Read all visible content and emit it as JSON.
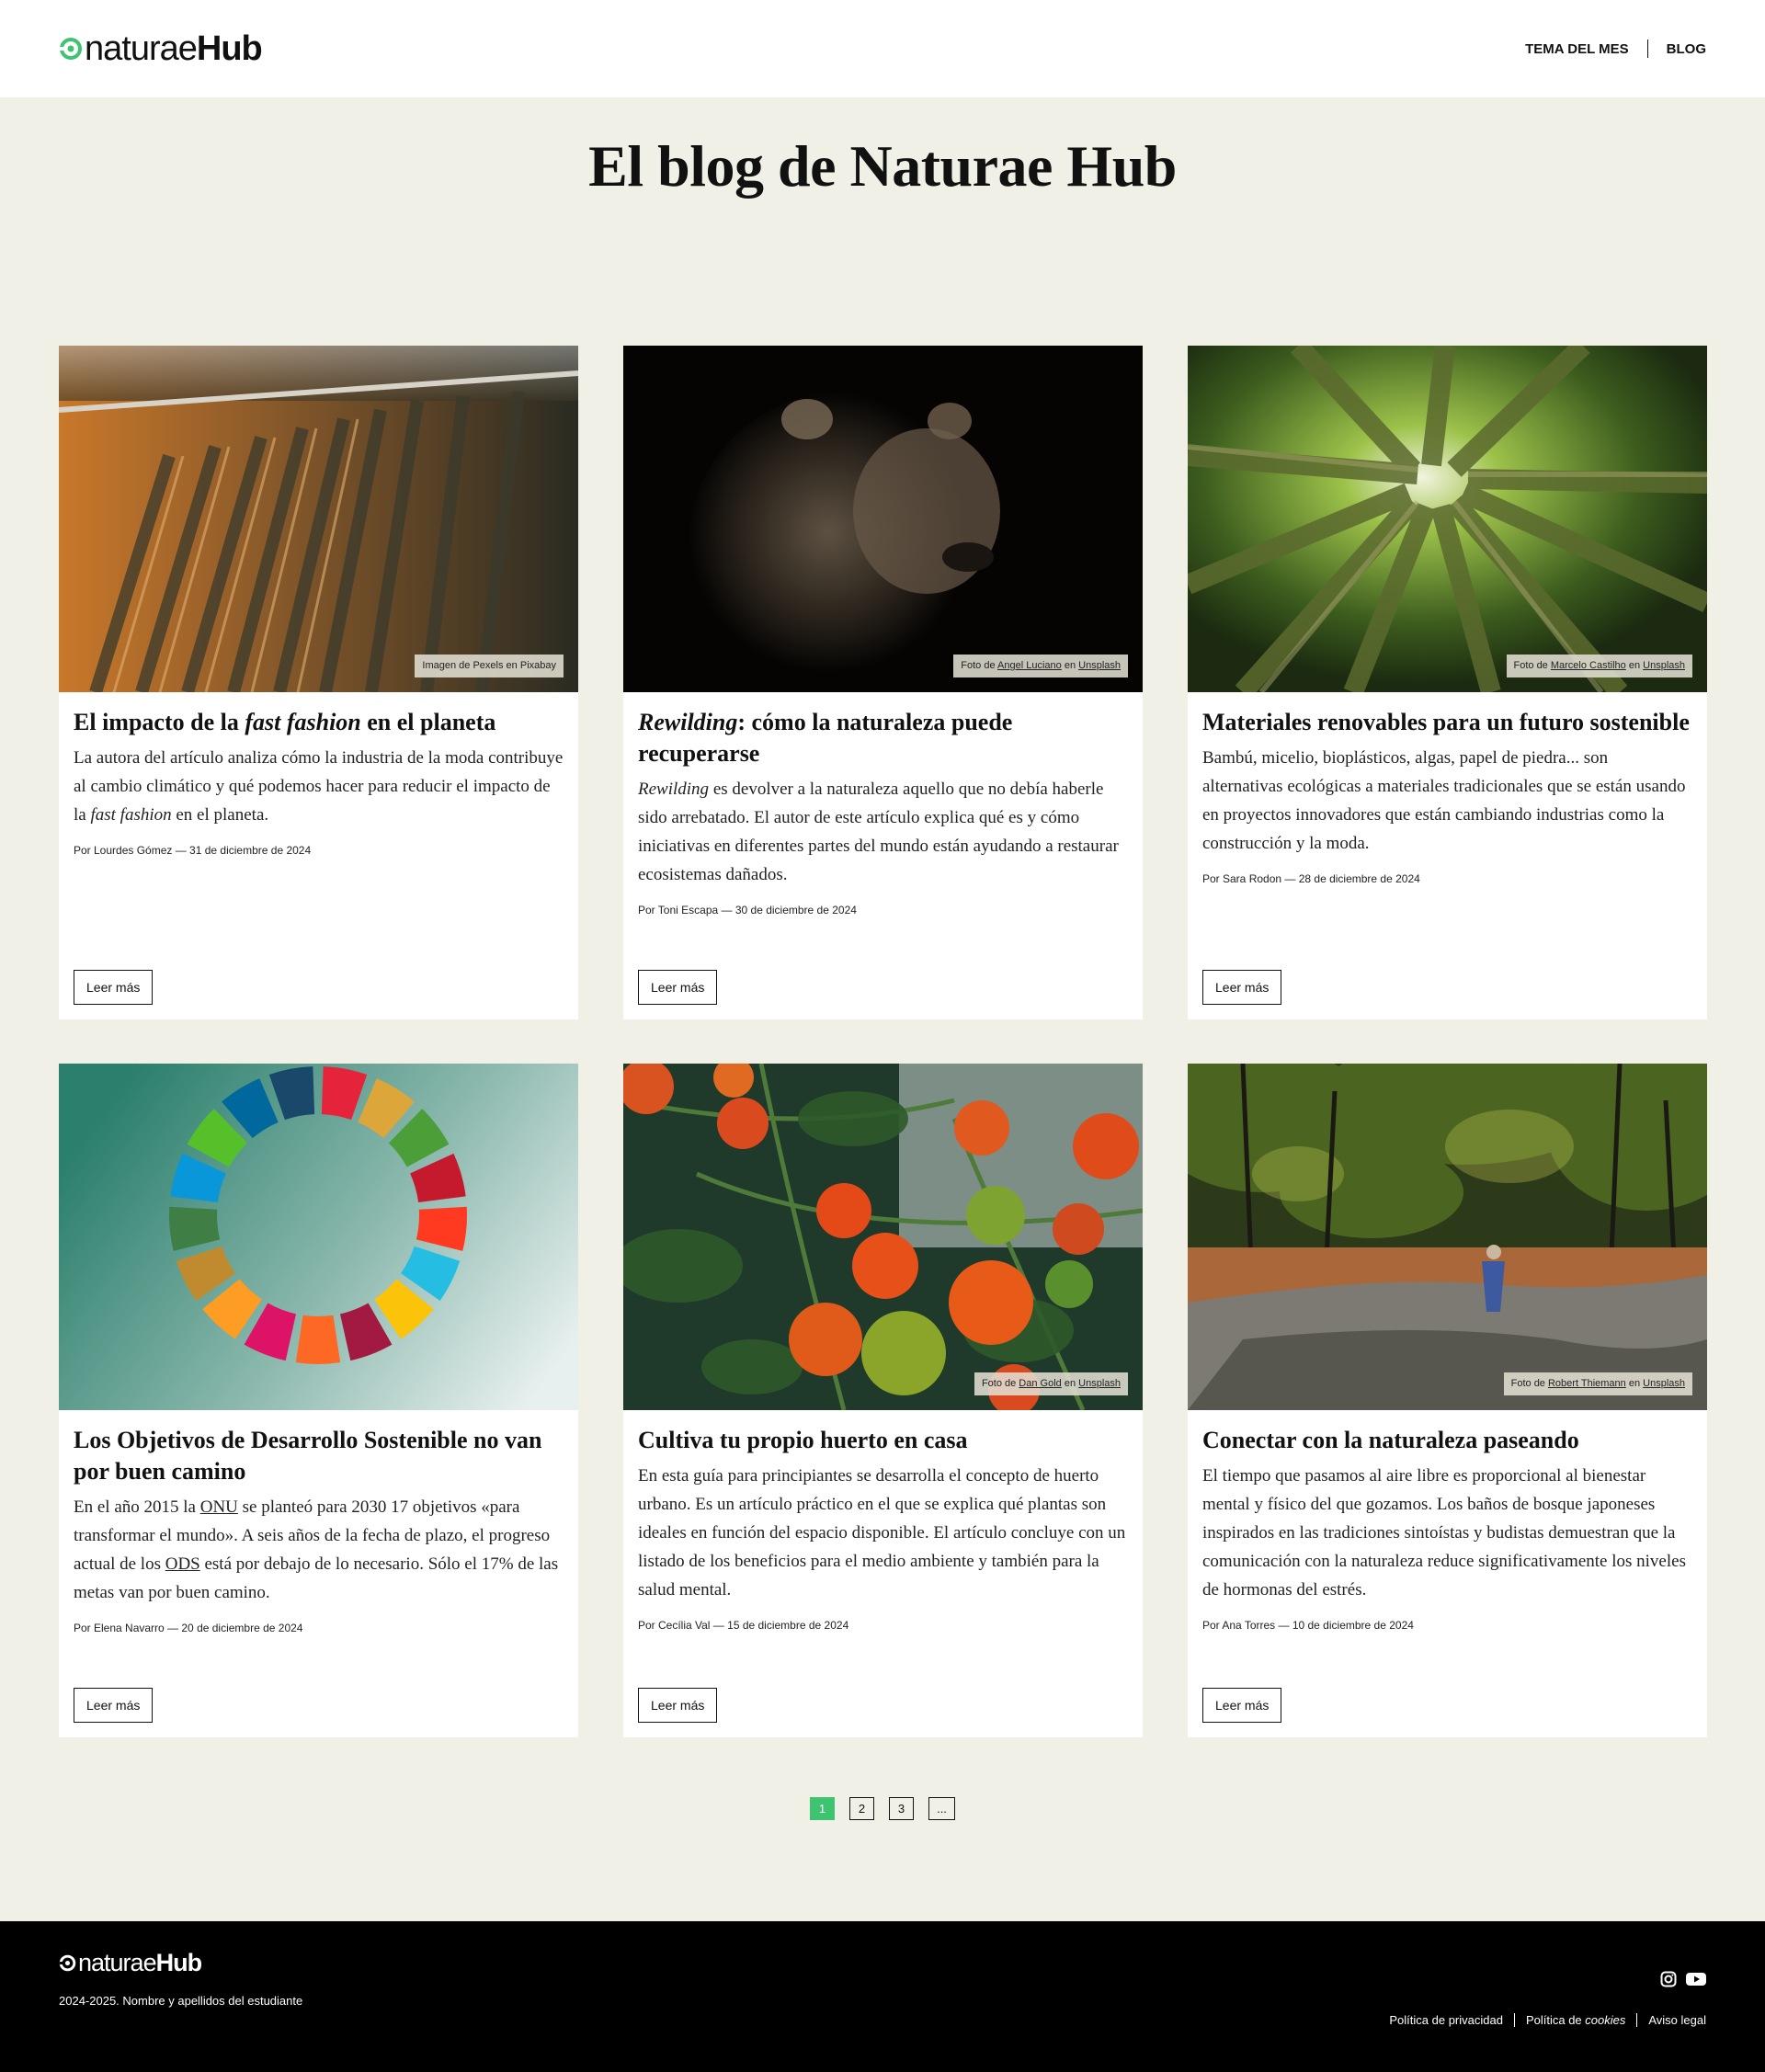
{
  "header": {
    "logo": {
      "word1": "natura",
      "word2": "e",
      "word3": "Hub"
    },
    "nav": [
      {
        "label": "TEMA DEL MES"
      },
      {
        "label": "BLOG"
      }
    ]
  },
  "page_title": "El blog de Naturae Hub",
  "cards": [
    {
      "credit": {
        "pre": "Imagen de ",
        "src": "Pexels",
        "mid": " en ",
        "site": "Pixabay"
      },
      "title_pre": "El impacto de la ",
      "title_em": "fast fashion",
      "title_post": " en el planeta",
      "desc_pre": "La autora del artículo analiza cómo la industria de la moda contribuye al cambio climático y qué podemos hacer para reducir el impacto de la ",
      "desc_em": "fast fashion",
      "desc_post": " en el planeta.",
      "meta": "Por Lourdes Gómez — 31 de diciembre de 2024",
      "button": "Leer más"
    },
    {
      "credit": {
        "pre": "Foto de ",
        "src": "Angel Luciano",
        "mid": " en ",
        "site": "Unsplash"
      },
      "title_em": "Rewilding",
      "title_post": ": cómo la naturaleza puede recuperarse",
      "desc_em": "Rewilding",
      "desc_post": " es devolver a la naturaleza aquello que no debía haberle sido arrebatado. El autor de este artículo explica qué es y cómo iniciativas en diferentes partes del mundo están ayudando a restaurar ecosistemas dañados.",
      "meta": "Por Toni Escapa — 30 de diciembre de 2024",
      "button": "Leer más"
    },
    {
      "credit": {
        "pre": "Foto de ",
        "src": "Marcelo Castilho",
        "mid": " en ",
        "site": "Unsplash"
      },
      "title": "Materiales renovables para un futuro sostenible",
      "desc": "Bambú, micelio, bioplásticos, algas, papel de piedra... son alternativas ecológicas a materiales tradicionales que se están usando en proyectos innovadores que están cambiando industrias como la construcción y la moda.",
      "meta": "Por Sara Rodon — 28 de diciembre de 2024",
      "button": "Leer más"
    },
    {
      "title": "Los Objetivos de Desarrollo Sostenible no van por buen camino",
      "desc_a": "En el año 2015 la ",
      "desc_link1": "ONU",
      "desc_b": " se planteó para 2030 17 objetivos «para transformar el mundo». A seis años de la fecha de plazo, el progreso actual de los ",
      "desc_link2": "ODS",
      "desc_c": " está por debajo de lo necesario. Sólo el 17% de las metas van por buen camino.",
      "meta": "Por Elena Navarro — 20 de diciembre de 2024",
      "button": "Leer más"
    },
    {
      "credit": {
        "pre": "Foto de ",
        "src": "Dan Gold",
        "mid": " en ",
        "site": "Unsplash"
      },
      "title": "Cultiva tu propio huerto en casa",
      "desc": "En esta guía para principiantes se desarrolla el concepto de huerto urbano. Es un artículo práctico en el que se explica qué plantas son ideales en función del espacio disponible. El artículo concluye con un listado de los beneficios para el medio ambiente y también para la salud mental.",
      "meta": "Por Cecília Val — 15 de diciembre de 2024",
      "button": "Leer más"
    },
    {
      "credit": {
        "pre": "Foto de ",
        "src": "Robert Thiemann",
        "mid": " en ",
        "site": "Unsplash"
      },
      "title": "Conectar con la naturaleza paseando",
      "desc": "El tiempo que pasamos al aire libre es proporcional al bienestar mental y físico del que gozamos. Los baños de bosque japoneses inspirados en las tradiciones sintoístas y budistas demuestran que la comunicación con la naturaleza reduce significativamente los niveles de hormonas del estrés.",
      "meta": "Por Ana Torres — 10 de diciembre de 2024",
      "button": "Leer más"
    }
  ],
  "pagination": [
    {
      "label": "1",
      "active": true
    },
    {
      "label": "2"
    },
    {
      "label": "3"
    },
    {
      "label": "..."
    }
  ],
  "footer": {
    "copyright": "2024-2025. Nombre y apellidos del estudiante",
    "legal": {
      "privacy": "Política de privacidad",
      "cookies_pre": "Política de ",
      "cookies_em": "cookies",
      "notice": "Aviso legal"
    },
    "socials": [
      "instagram-icon",
      "youtube-icon"
    ]
  },
  "colors": {
    "brand_green": "#3ec371",
    "bg": "#f0f0e6",
    "footer": "#000000"
  }
}
